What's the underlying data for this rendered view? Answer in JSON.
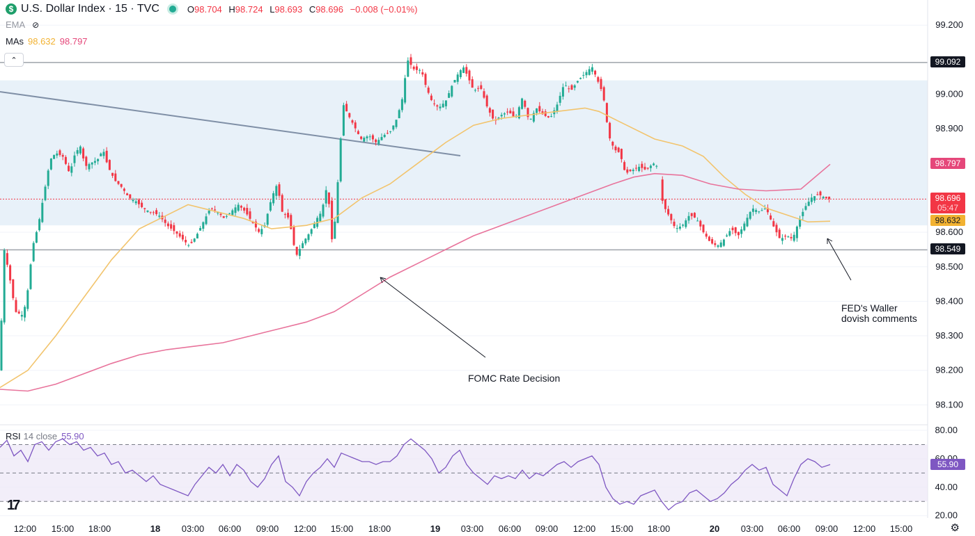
{
  "header": {
    "symbol_icon": "$",
    "title": "U.S. Dollar Index · 15 · TVC",
    "open_label": "O",
    "open": "98.704",
    "high_label": "H",
    "high": "98.724",
    "low_label": "L",
    "low": "98.693",
    "close_label": "C",
    "close": "98.696",
    "change": "−0.008 (−0.01%)"
  },
  "indicators": {
    "ema_label": "EMA",
    "mas_label": "MAs",
    "ma_fast": "98.632",
    "ma_slow": "98.797",
    "collapse_icon": "chevron-up-icon",
    "rsi_label": "RSI",
    "rsi_params": "14 close",
    "rsi_value": "55.90"
  },
  "price_tags": {
    "resistance": "99.092",
    "ma_slow": "98.797",
    "last_price": "98.696",
    "countdown": "05:47",
    "ma_fast": "98.632",
    "support": "98.549",
    "rsi": "55.90"
  },
  "annotations": {
    "fomc": "FOMC Rate Decision",
    "waller_line1": "FED's Waller",
    "waller_line2": "dovish comments"
  },
  "colors": {
    "up": "#22ab94",
    "down": "#f23645",
    "ma_fast": "#f2c46d",
    "ma_slow": "#e8739b",
    "rsi": "#7e57c2",
    "zone": "#e8f1f9"
  },
  "chart_data": {
    "type": "candlestick",
    "price_ticks": [
      "99.200",
      "99.000",
      "98.900",
      "98.800",
      "98.700",
      "98.600",
      "98.500",
      "98.400",
      "98.300",
      "98.200",
      "98.100"
    ],
    "rsi_ticks": [
      "80.00",
      "60.00",
      "40.00",
      "20.00"
    ],
    "x_ticks": [
      "12:00",
      "15:00",
      "18:00",
      "18",
      "03:00",
      "06:00",
      "09:00",
      "12:00",
      "15:00",
      "18:00",
      "19",
      "03:00",
      "06:00",
      "09:00",
      "12:00",
      "15:00",
      "18:00",
      "20",
      "03:00",
      "06:00",
      "09:00",
      "12:00",
      "15:00"
    ],
    "horizontal_levels": [
      99.092,
      98.549
    ],
    "zone": [
      98.62,
      99.04
    ],
    "rsi_bands": [
      30,
      50,
      70
    ],
    "last_price": 98.696,
    "ma_fast_last": 98.632,
    "ma_slow_last": 98.797,
    "rsi_last": 55.9,
    "price_path": [
      [
        0,
        98.2
      ],
      [
        5,
        98.56
      ],
      [
        13,
        98.48
      ],
      [
        22,
        98.37
      ],
      [
        32,
        98.36
      ],
      [
        38,
        98.4
      ],
      [
        47,
        98.56
      ],
      [
        55,
        98.62
      ],
      [
        63,
        98.71
      ],
      [
        72,
        98.81
      ],
      [
        80,
        98.83
      ],
      [
        90,
        98.82
      ],
      [
        100,
        98.77
      ],
      [
        108,
        98.83
      ],
      [
        116,
        98.85
      ],
      [
        122,
        98.79
      ],
      [
        130,
        98.8
      ],
      [
        140,
        98.81
      ],
      [
        148,
        98.84
      ],
      [
        155,
        98.79
      ],
      [
        165,
        98.75
      ],
      [
        175,
        98.73
      ],
      [
        185,
        98.7
      ],
      [
        195,
        98.69
      ],
      [
        205,
        98.67
      ],
      [
        215,
        98.66
      ],
      [
        228,
        98.65
      ],
      [
        240,
        98.62
      ],
      [
        252,
        98.6
      ],
      [
        262,
        98.58
      ],
      [
        272,
        98.56
      ],
      [
        282,
        98.59
      ],
      [
        292,
        98.63
      ],
      [
        302,
        98.67
      ],
      [
        312,
        98.66
      ],
      [
        322,
        98.64
      ],
      [
        332,
        98.66
      ],
      [
        342,
        98.68
      ],
      [
        352,
        98.66
      ],
      [
        362,
        98.63
      ],
      [
        372,
        98.6
      ],
      [
        380,
        98.62
      ],
      [
        390,
        98.7
      ],
      [
        398,
        98.74
      ],
      [
        405,
        98.66
      ],
      [
        415,
        98.64
      ],
      [
        425,
        98.53
      ],
      [
        435,
        98.57
      ],
      [
        445,
        98.6
      ],
      [
        455,
        98.64
      ],
      [
        462,
        98.66
      ],
      [
        470,
        98.74
      ],
      [
        477,
        98.57
      ],
      [
        482,
        98.65
      ],
      [
        488,
        98.84
      ],
      [
        493,
        98.97
      ],
      [
        500,
        98.94
      ],
      [
        508,
        98.91
      ],
      [
        518,
        98.87
      ],
      [
        530,
        98.88
      ],
      [
        540,
        98.86
      ],
      [
        550,
        98.88
      ],
      [
        560,
        98.89
      ],
      [
        570,
        98.93
      ],
      [
        578,
        98.99
      ],
      [
        585,
        99.1
      ],
      [
        595,
        99.07
      ],
      [
        605,
        99.07
      ],
      [
        612,
        99.02
      ],
      [
        620,
        98.98
      ],
      [
        630,
        98.96
      ],
      [
        640,
        98.98
      ],
      [
        650,
        99.03
      ],
      [
        658,
        99.06
      ],
      [
        665,
        99.08
      ],
      [
        672,
        99.05
      ],
      [
        680,
        99.01
      ],
      [
        690,
        99.02
      ],
      [
        700,
        98.96
      ],
      [
        710,
        98.92
      ],
      [
        720,
        98.94
      ],
      [
        730,
        98.95
      ],
      [
        740,
        98.93
      ],
      [
        750,
        98.99
      ],
      [
        760,
        98.92
      ],
      [
        770,
        98.96
      ],
      [
        780,
        98.94
      ],
      [
        790,
        98.93
      ],
      [
        800,
        98.97
      ],
      [
        810,
        99.03
      ],
      [
        820,
        99.01
      ],
      [
        830,
        99.04
      ],
      [
        840,
        99.06
      ],
      [
        850,
        99.08
      ],
      [
        858,
        99.04
      ],
      [
        866,
        99.0
      ],
      [
        874,
        98.88
      ],
      [
        882,
        98.84
      ],
      [
        890,
        98.83
      ],
      [
        898,
        98.77
      ],
      [
        908,
        98.78
      ],
      [
        918,
        98.79
      ],
      [
        928,
        98.78
      ],
      [
        938,
        98.8
      ],
      [
        944,
        98.79
      ],
      [
        952,
        98.68
      ],
      [
        960,
        98.65
      ],
      [
        970,
        98.61
      ],
      [
        980,
        98.62
      ],
      [
        990,
        98.65
      ],
      [
        1000,
        98.64
      ],
      [
        1010,
        98.6
      ],
      [
        1020,
        98.57
      ],
      [
        1030,
        98.56
      ],
      [
        1040,
        98.58
      ],
      [
        1050,
        98.61
      ],
      [
        1060,
        98.59
      ],
      [
        1070,
        98.63
      ],
      [
        1080,
        98.67
      ],
      [
        1090,
        98.66
      ],
      [
        1100,
        98.67
      ],
      [
        1110,
        98.62
      ],
      [
        1120,
        98.58
      ],
      [
        1130,
        98.59
      ],
      [
        1138,
        98.58
      ],
      [
        1145,
        98.62
      ],
      [
        1155,
        98.67
      ],
      [
        1165,
        98.7
      ],
      [
        1175,
        98.71
      ],
      [
        1185,
        98.7
      ],
      [
        1192,
        98.696
      ]
    ],
    "ma_fast_path": [
      [
        0,
        98.15
      ],
      [
        40,
        98.2
      ],
      [
        80,
        98.3
      ],
      [
        120,
        98.41
      ],
      [
        160,
        98.52
      ],
      [
        200,
        98.61
      ],
      [
        240,
        98.65
      ],
      [
        270,
        98.68
      ],
      [
        310,
        98.66
      ],
      [
        350,
        98.64
      ],
      [
        390,
        98.61
      ],
      [
        440,
        98.62
      ],
      [
        480,
        98.64
      ],
      [
        520,
        98.7
      ],
      [
        560,
        98.74
      ],
      [
        600,
        98.8
      ],
      [
        640,
        98.86
      ],
      [
        680,
        98.91
      ],
      [
        720,
        98.93
      ],
      [
        760,
        98.94
      ],
      [
        800,
        98.95
      ],
      [
        840,
        98.96
      ],
      [
        860,
        98.95
      ],
      [
        900,
        98.91
      ],
      [
        940,
        98.87
      ],
      [
        980,
        98.85
      ],
      [
        1010,
        98.82
      ],
      [
        1040,
        98.76
      ],
      [
        1070,
        98.71
      ],
      [
        1100,
        98.67
      ],
      [
        1130,
        98.65
      ],
      [
        1160,
        98.63
      ],
      [
        1192,
        98.632
      ]
    ],
    "ma_slow_path": [
      [
        0,
        98.145
      ],
      [
        40,
        98.14
      ],
      [
        80,
        98.16
      ],
      [
        120,
        98.19
      ],
      [
        160,
        98.22
      ],
      [
        200,
        98.245
      ],
      [
        240,
        98.26
      ],
      [
        280,
        98.27
      ],
      [
        320,
        98.28
      ],
      [
        360,
        98.3
      ],
      [
        400,
        98.32
      ],
      [
        440,
        98.34
      ],
      [
        480,
        98.37
      ],
      [
        520,
        98.42
      ],
      [
        560,
        98.47
      ],
      [
        600,
        98.51
      ],
      [
        640,
        98.55
      ],
      [
        680,
        98.59
      ],
      [
        720,
        98.62
      ],
      [
        760,
        98.65
      ],
      [
        800,
        98.68
      ],
      [
        840,
        98.71
      ],
      [
        880,
        98.74
      ],
      [
        910,
        98.76
      ],
      [
        940,
        98.77
      ],
      [
        980,
        98.765
      ],
      [
        1020,
        98.74
      ],
      [
        1060,
        98.725
      ],
      [
        1100,
        98.72
      ],
      [
        1150,
        98.725
      ],
      [
        1192,
        98.797
      ]
    ],
    "rsi_path": [
      [
        0,
        68
      ],
      [
        10,
        73
      ],
      [
        20,
        62
      ],
      [
        30,
        66
      ],
      [
        40,
        58
      ],
      [
        50,
        70
      ],
      [
        60,
        72
      ],
      [
        70,
        66
      ],
      [
        80,
        72
      ],
      [
        90,
        74
      ],
      [
        100,
        70
      ],
      [
        110,
        72
      ],
      [
        120,
        66
      ],
      [
        130,
        68
      ],
      [
        140,
        62
      ],
      [
        150,
        64
      ],
      [
        160,
        56
      ],
      [
        170,
        58
      ],
      [
        180,
        50
      ],
      [
        190,
        52
      ],
      [
        200,
        48
      ],
      [
        210,
        44
      ],
      [
        220,
        48
      ],
      [
        230,
        42
      ],
      [
        240,
        40
      ],
      [
        250,
        38
      ],
      [
        260,
        36
      ],
      [
        270,
        34
      ],
      [
        280,
        42
      ],
      [
        290,
        48
      ],
      [
        300,
        54
      ],
      [
        310,
        50
      ],
      [
        320,
        56
      ],
      [
        330,
        48
      ],
      [
        340,
        56
      ],
      [
        350,
        52
      ],
      [
        360,
        44
      ],
      [
        370,
        40
      ],
      [
        380,
        46
      ],
      [
        390,
        56
      ],
      [
        400,
        62
      ],
      [
        410,
        44
      ],
      [
        420,
        40
      ],
      [
        430,
        34
      ],
      [
        440,
        44
      ],
      [
        450,
        50
      ],
      [
        460,
        54
      ],
      [
        470,
        60
      ],
      [
        480,
        54
      ],
      [
        490,
        64
      ],
      [
        500,
        62
      ],
      [
        510,
        60
      ],
      [
        520,
        58
      ],
      [
        530,
        58
      ],
      [
        540,
        56
      ],
      [
        550,
        58
      ],
      [
        560,
        58
      ],
      [
        570,
        62
      ],
      [
        580,
        70
      ],
      [
        590,
        74
      ],
      [
        600,
        70
      ],
      [
        610,
        66
      ],
      [
        620,
        60
      ],
      [
        630,
        50
      ],
      [
        640,
        54
      ],
      [
        650,
        62
      ],
      [
        660,
        66
      ],
      [
        670,
        56
      ],
      [
        680,
        50
      ],
      [
        690,
        46
      ],
      [
        700,
        42
      ],
      [
        710,
        48
      ],
      [
        720,
        46
      ],
      [
        730,
        48
      ],
      [
        740,
        46
      ],
      [
        750,
        52
      ],
      [
        760,
        46
      ],
      [
        770,
        50
      ],
      [
        780,
        48
      ],
      [
        790,
        52
      ],
      [
        800,
        56
      ],
      [
        810,
        58
      ],
      [
        820,
        54
      ],
      [
        830,
        58
      ],
      [
        840,
        60
      ],
      [
        850,
        62
      ],
      [
        860,
        56
      ],
      [
        870,
        40
      ],
      [
        880,
        32
      ],
      [
        890,
        28
      ],
      [
        900,
        30
      ],
      [
        910,
        28
      ],
      [
        920,
        34
      ],
      [
        930,
        36
      ],
      [
        940,
        38
      ],
      [
        950,
        30
      ],
      [
        960,
        24
      ],
      [
        970,
        28
      ],
      [
        980,
        30
      ],
      [
        990,
        36
      ],
      [
        1000,
        38
      ],
      [
        1010,
        34
      ],
      [
        1020,
        30
      ],
      [
        1030,
        32
      ],
      [
        1040,
        36
      ],
      [
        1050,
        42
      ],
      [
        1060,
        46
      ],
      [
        1070,
        52
      ],
      [
        1080,
        56
      ],
      [
        1090,
        52
      ],
      [
        1100,
        54
      ],
      [
        1110,
        42
      ],
      [
        1120,
        38
      ],
      [
        1130,
        34
      ],
      [
        1140,
        46
      ],
      [
        1150,
        56
      ],
      [
        1160,
        60
      ],
      [
        1170,
        58
      ],
      [
        1180,
        54
      ],
      [
        1192,
        55.9
      ]
    ]
  }
}
